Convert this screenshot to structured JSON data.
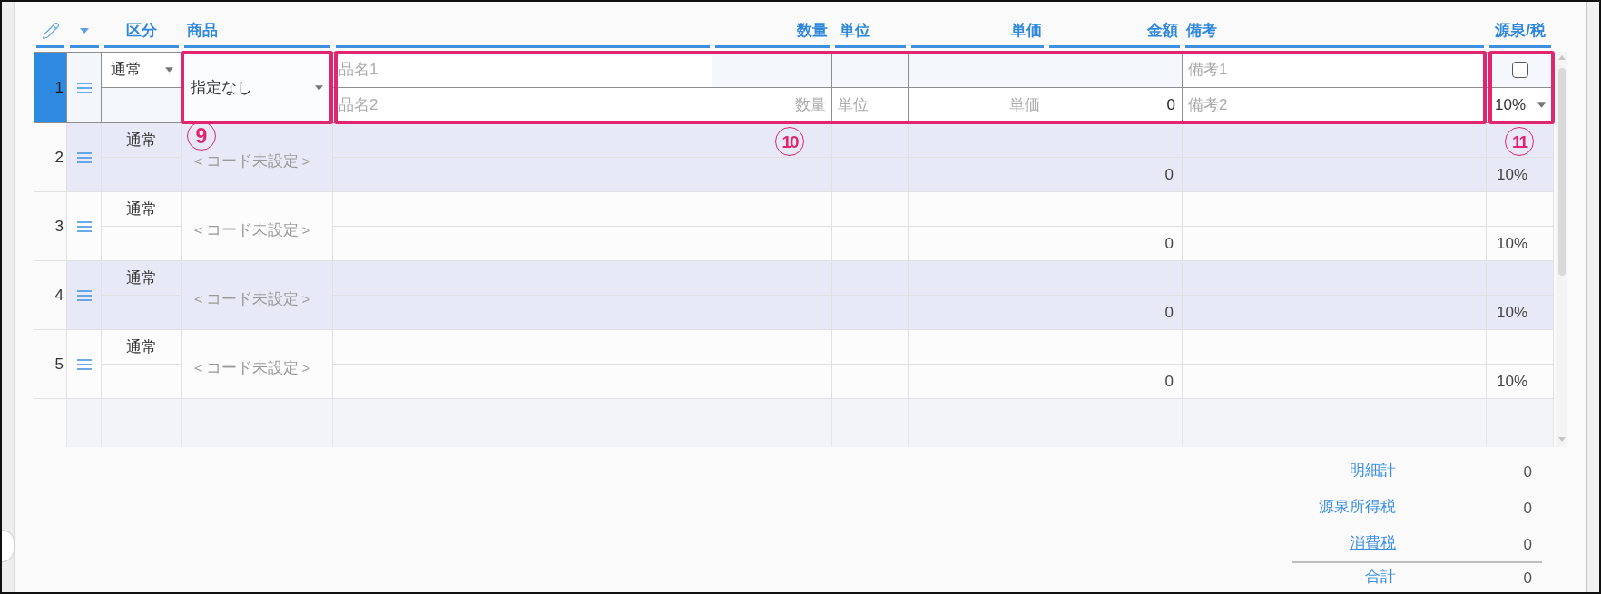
{
  "header": {
    "columns": [
      {
        "kind": "pencil"
      },
      {
        "kind": "caret"
      },
      {
        "kind": "label",
        "label": "区分"
      },
      {
        "kind": "label",
        "label": "商品"
      },
      {
        "kind": "blank"
      },
      {
        "kind": "label",
        "label": "数量"
      },
      {
        "kind": "label",
        "label": "単位"
      },
      {
        "kind": "label",
        "label": "単価"
      },
      {
        "kind": "label",
        "label": "金額"
      },
      {
        "kind": "label",
        "label": "備考"
      },
      {
        "kind": "label",
        "label": "源泉/税"
      }
    ]
  },
  "table": {
    "rows": [
      {
        "kind": "editor",
        "selected": true,
        "number": "1",
        "category": "通常",
        "product": "指定なし",
        "item_name_1": {
          "placeholder": "品名1"
        },
        "item_name_2": {
          "placeholder": "品名2"
        },
        "quantity": {
          "placeholder": "数量"
        },
        "unit": {
          "placeholder": "単位"
        },
        "unit_price": {
          "placeholder": "単価"
        },
        "amount": "0",
        "note_1": {
          "placeholder": "備考1"
        },
        "note_2": {
          "placeholder": "備考2"
        },
        "withholding": {
          "checked": false
        },
        "tax_rate": "10%"
      },
      {
        "kind": "display",
        "selected": false,
        "number": "2",
        "category": "通常",
        "product": "＜コード未設定＞",
        "amount": "0",
        "tax_rate": "10%"
      },
      {
        "kind": "display",
        "selected": false,
        "number": "3",
        "category": "通常",
        "product": "＜コード未設定＞",
        "amount": "0",
        "tax_rate": "10%"
      },
      {
        "kind": "display",
        "selected": false,
        "number": "4",
        "category": "通常",
        "product": "＜コード未設定＞",
        "amount": "0",
        "tax_rate": "10%"
      },
      {
        "kind": "display",
        "selected": false,
        "number": "5",
        "category": "通常",
        "product": "＜コード未設定＞",
        "amount": "0",
        "tax_rate": "10%"
      }
    ]
  },
  "annotations": [
    {
      "number": "9"
    },
    {
      "number": "10"
    },
    {
      "number": "11"
    }
  ],
  "summary": [
    {
      "kind": "plain",
      "label": "明細計",
      "value": "0"
    },
    {
      "kind": "plain",
      "label": "源泉所得税",
      "value": "0"
    },
    {
      "kind": "link",
      "label": "消費税",
      "value": "0"
    },
    {
      "kind": "total",
      "label": "合計",
      "value": "0"
    }
  ]
}
